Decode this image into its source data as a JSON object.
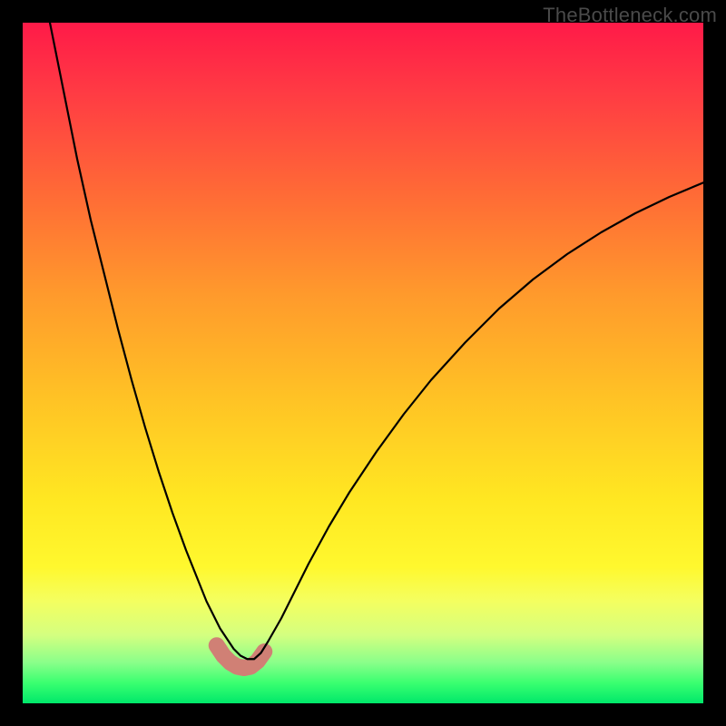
{
  "watermark": "TheBottleneck.com",
  "chart_data": {
    "type": "line",
    "title": "",
    "xlabel": "",
    "ylabel": "",
    "xlim": [
      0,
      100
    ],
    "ylim": [
      0,
      100
    ],
    "series": [
      {
        "name": "bottleneck-curve",
        "x": [
          4,
          6,
          8,
          10,
          12,
          14,
          16,
          18,
          20,
          22,
          24,
          26,
          27,
          28,
          29,
          30,
          31,
          32,
          33,
          34,
          35,
          36,
          38,
          40,
          42,
          45,
          48,
          52,
          56,
          60,
          65,
          70,
          75,
          80,
          85,
          90,
          95,
          100
        ],
        "y": [
          100,
          90,
          80,
          71,
          63,
          55,
          47.5,
          40.5,
          34,
          28,
          22.5,
          17.5,
          15,
          13,
          11,
          9.5,
          8,
          7,
          6.5,
          6.5,
          7.4,
          9,
          12.5,
          16.5,
          20.5,
          26,
          31,
          37,
          42.5,
          47.5,
          53,
          58,
          62.3,
          66,
          69.2,
          72,
          74.4,
          76.5
        ]
      },
      {
        "name": "highlight-band",
        "stroke": "#d98880",
        "stroke_width": 18,
        "x": [
          28.5,
          29.5,
          30.5,
          31.5,
          32.5,
          33.5,
          34.5,
          35.5
        ],
        "y": [
          8.5,
          7.0,
          6.0,
          5.4,
          5.2,
          5.4,
          6.2,
          7.6
        ]
      }
    ],
    "background_gradient_stops": [
      {
        "pos": 0.0,
        "color": "#ff1a48"
      },
      {
        "pos": 0.25,
        "color": "#ff6a36"
      },
      {
        "pos": 0.55,
        "color": "#ffc225"
      },
      {
        "pos": 0.8,
        "color": "#fff82e"
      },
      {
        "pos": 0.94,
        "color": "#8aff8a"
      },
      {
        "pos": 1.0,
        "color": "#00e86a"
      }
    ]
  }
}
